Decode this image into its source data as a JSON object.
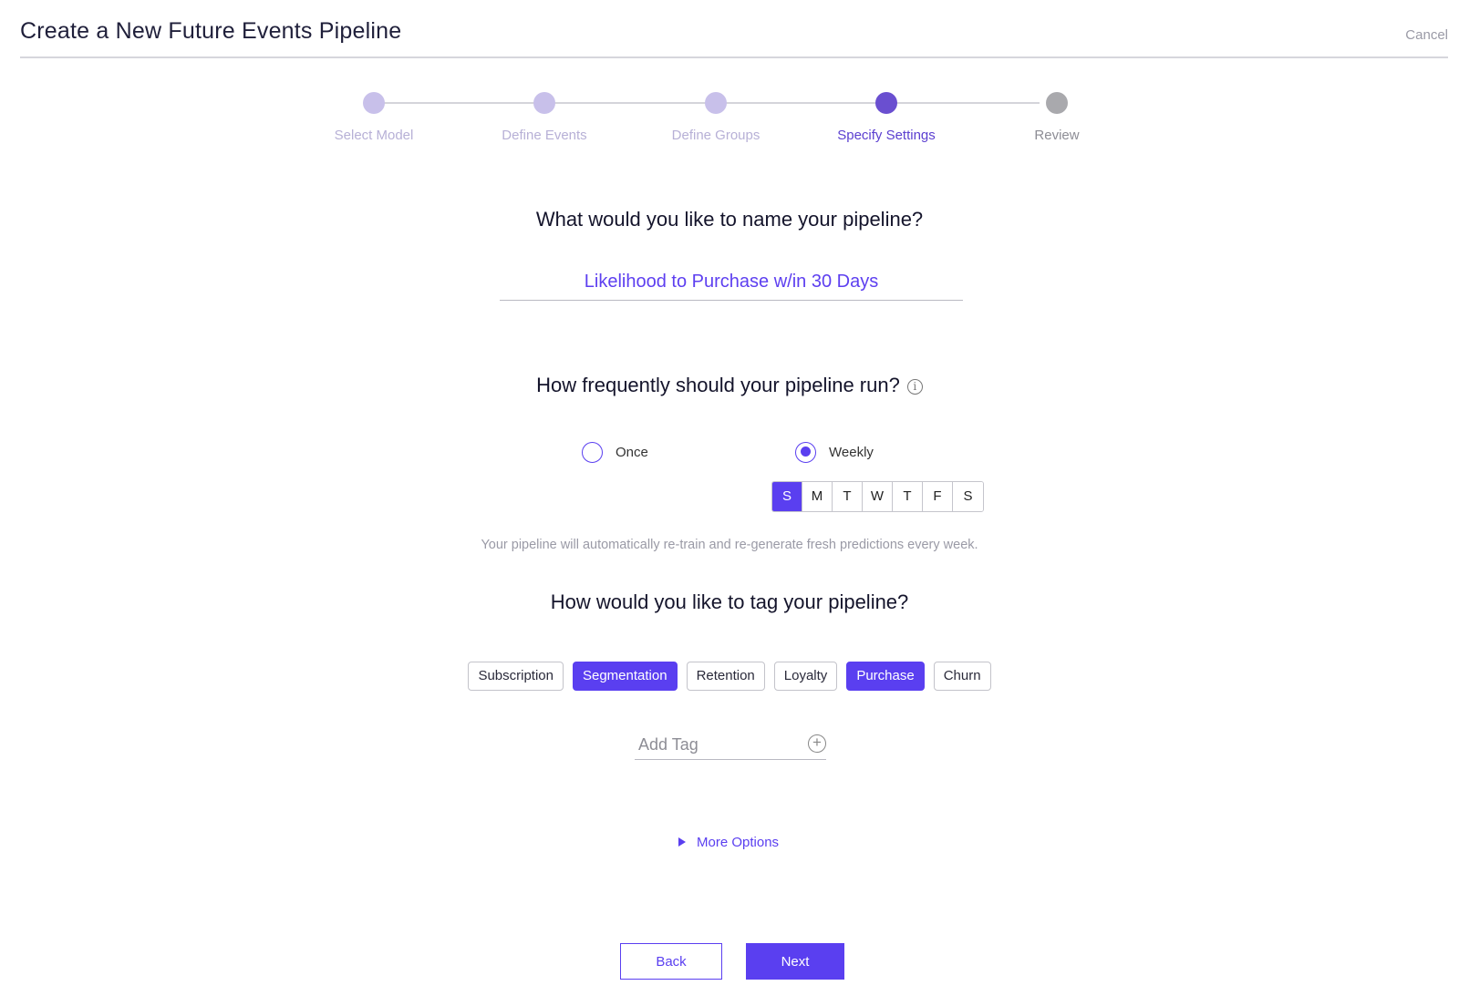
{
  "header": {
    "title": "Create a New Future Events Pipeline",
    "cancel_label": "Cancel"
  },
  "stepper": {
    "steps": [
      {
        "label": "Select Model",
        "state": "completed"
      },
      {
        "label": "Define Events",
        "state": "completed"
      },
      {
        "label": "Define Groups",
        "state": "completed"
      },
      {
        "label": "Specify Settings",
        "state": "active"
      },
      {
        "label": "Review",
        "state": "upcoming"
      }
    ]
  },
  "name_section": {
    "question": "What would you like to name your pipeline?",
    "value": "Likelihood to Purchase w/in 30 Days"
  },
  "frequency_section": {
    "question": "How frequently should your pipeline run?",
    "info_icon": "info-icon",
    "options": [
      {
        "label": "Once",
        "checked": false
      },
      {
        "label": "Weekly",
        "checked": true
      }
    ],
    "days": [
      {
        "label": "S",
        "selected": true
      },
      {
        "label": "M",
        "selected": false
      },
      {
        "label": "T",
        "selected": false
      },
      {
        "label": "W",
        "selected": false
      },
      {
        "label": "T",
        "selected": false
      },
      {
        "label": "F",
        "selected": false
      },
      {
        "label": "S",
        "selected": false
      }
    ],
    "hint": "Your pipeline will automatically re-train and re-generate fresh predictions every week."
  },
  "tags_section": {
    "question": "How would you like to tag your pipeline?",
    "tags": [
      {
        "label": "Subscription",
        "selected": false
      },
      {
        "label": "Segmentation",
        "selected": true
      },
      {
        "label": "Retention",
        "selected": false
      },
      {
        "label": "Loyalty",
        "selected": false
      },
      {
        "label": "Purchase",
        "selected": true
      },
      {
        "label": "Churn",
        "selected": false
      }
    ],
    "add_tag_placeholder": "Add Tag",
    "add_tag_icon": "plus-circle-icon"
  },
  "more_options_label": "More Options",
  "footer": {
    "back_label": "Back",
    "next_label": "Next"
  },
  "colors": {
    "accent": "#5a3ff0",
    "step_done": "#c8c0ea",
    "step_active": "#6a4fd0",
    "step_upcoming": "#a9a9ad"
  }
}
